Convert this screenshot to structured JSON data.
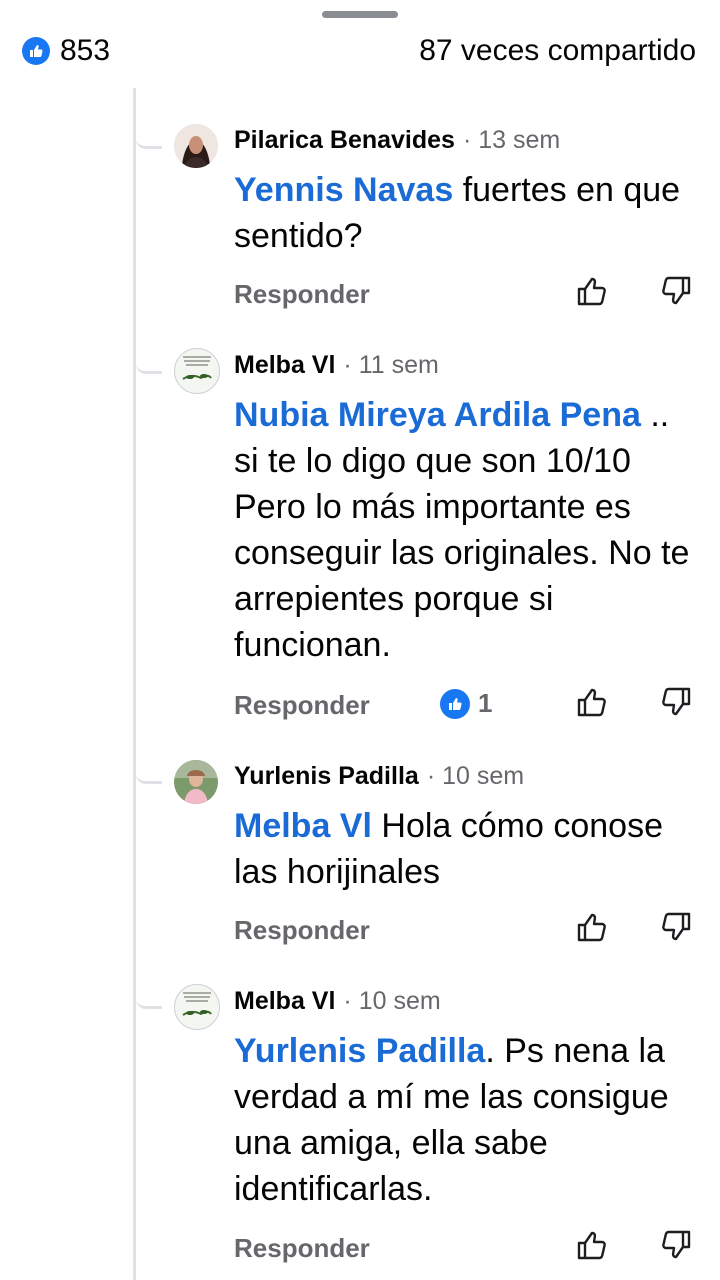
{
  "header": {
    "likes_count": "853",
    "shares_label": "87 veces compartido",
    "like_icon": "thumbs-up-icon"
  },
  "comments": [
    {
      "author": "Pilarica Benavides",
      "time": "· 13 sem",
      "mention": "Yennis Navas",
      "text": " fuertes en que sentido?",
      "reply_label": "Responder",
      "reaction_count": ""
    },
    {
      "author": "Melba Vl",
      "time": "· 11 sem",
      "mention": "Nubia Mireya Ardila Pena",
      "text": " .. si te lo digo que son 10/10 Pero lo más importante es conseguir las originales. No te arrepientes porque si funcionan.",
      "reply_label": "Responder",
      "reaction_count": "1"
    },
    {
      "author": "Yurlenis Padilla",
      "time": "· 10 sem",
      "mention": "Melba Vl",
      "text": " Hola cómo conose las horijinales",
      "reply_label": "Responder",
      "reaction_count": ""
    },
    {
      "author": "Melba Vl",
      "time": "· 10 sem",
      "mention": "Yurlenis Padilla",
      "text": ". Ps nena la verdad a mí me las consigue una amiga, ella sabe identificarlas.",
      "reply_label": "Responder",
      "reaction_count": ""
    }
  ],
  "colors": {
    "brand_blue": "#1877f2",
    "mention_blue": "#1a6bd6",
    "secondary_text": "#65676b"
  }
}
